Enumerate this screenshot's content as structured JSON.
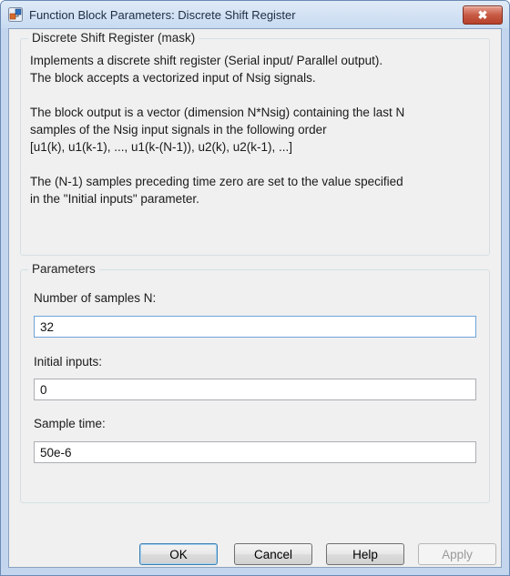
{
  "window": {
    "title": "Function Block Parameters: Discrete Shift Register",
    "close_glyph": "✖"
  },
  "description_group": {
    "title": "Discrete Shift Register (mask)",
    "paragraphs": [
      "Implements a discrete shift register (Serial input/ Parallel output).\nThe block accepts a vectorized input of Nsig signals.",
      "The block output is a vector (dimension N*Nsig) containing the last N\nsamples of the Nsig input signals in the following order\n[u1(k), u1(k-1), ..., u1(k-(N-1)),  u2(k), u2(k-1), ...]",
      "The (N-1) samples preceding time zero are set to the value specified\nin the \"Initial inputs\" parameter."
    ]
  },
  "parameters_group": {
    "title": "Parameters",
    "fields": [
      {
        "label": "Number of samples N:",
        "value": "32"
      },
      {
        "label": "Initial inputs:",
        "value": "0"
      },
      {
        "label": "Sample time:",
        "value": "50e-6"
      }
    ]
  },
  "buttons": {
    "ok": "OK",
    "cancel": "Cancel",
    "help": "Help",
    "apply": "Apply"
  },
  "icons": {
    "app": "simulink-block-icon",
    "close": "close-icon"
  },
  "colors": {
    "titlebar": "#c8dbf1",
    "close_button": "#c75a44",
    "dialog_background": "#f0f0f0",
    "focus_border": "#6fa3d8"
  }
}
